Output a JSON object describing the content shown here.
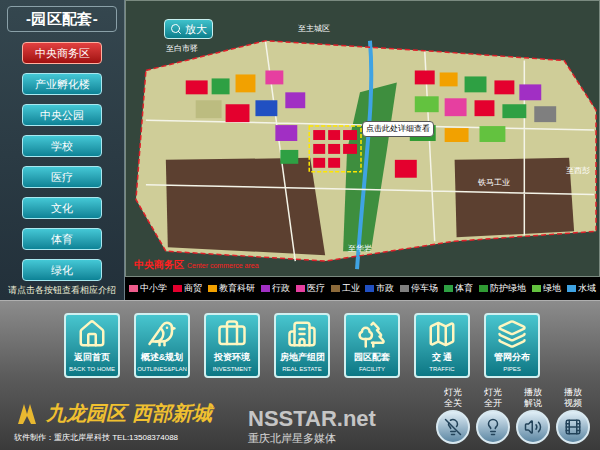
{
  "sidebar": {
    "title": "-园区配套-",
    "items": [
      {
        "label": "中央商务区",
        "selected": true
      },
      {
        "label": "产业孵化楼",
        "selected": false
      },
      {
        "label": "中央公园",
        "selected": false
      },
      {
        "label": "学校",
        "selected": false
      },
      {
        "label": "医疗",
        "selected": false
      },
      {
        "label": "文化",
        "selected": false
      },
      {
        "label": "体育",
        "selected": false
      },
      {
        "label": "绿化",
        "selected": false
      }
    ],
    "hint": "请点击各按钮查看相应介绍"
  },
  "map": {
    "zoom_button": "放大",
    "labels": [
      "至白市驿",
      "至主城区",
      "至西彭",
      "铁马工业",
      "至华岩"
    ],
    "callout": "点击此处详细查看",
    "area_title": "中央商务区",
    "area_subtitle": "Center commerce area"
  },
  "legend": [
    {
      "label": "中小学",
      "color": "#ee5c8c"
    },
    {
      "label": "商贸",
      "color": "#e4002e"
    },
    {
      "label": "教育科研",
      "color": "#f2a100"
    },
    {
      "label": "行政",
      "color": "#a12fc4"
    },
    {
      "label": "医疗",
      "color": "#e63fa0"
    },
    {
      "label": "工业",
      "color": "#8c6a3a"
    },
    {
      "label": "市政",
      "color": "#2150c2"
    },
    {
      "label": "停车场",
      "color": "#7f7f7f"
    },
    {
      "label": "体育",
      "color": "#2ea043"
    },
    {
      "label": "防护绿地",
      "color": "#2f9a33"
    },
    {
      "label": "绿地",
      "color": "#63c23f"
    },
    {
      "label": "水域",
      "color": "#3fa3e3"
    }
  ],
  "nav": [
    {
      "label": "返回首页",
      "sublabel": "BACK TO HOME"
    },
    {
      "label": "概述&规划",
      "sublabel": "OUTLINES&PLAN"
    },
    {
      "label": "投资环境",
      "sublabel": "INVESTMENT"
    },
    {
      "label": "房地产组团",
      "sublabel": "REAL ESTATE"
    },
    {
      "label": "园区配套",
      "sublabel": "FACILITY"
    },
    {
      "label": "交 通",
      "sublabel": "TRAFFIC"
    },
    {
      "label": "管网分布",
      "sublabel": "PIPES"
    }
  ],
  "logo": {
    "name": "九龙园区",
    "slogan": "西部新城"
  },
  "controls": [
    {
      "label": "灯光全关"
    },
    {
      "label": "灯光全开"
    },
    {
      "label": "播放解说"
    },
    {
      "label": "播放视频"
    }
  ],
  "credit": "软件制作：重庆北岸星科技 TEL:13508374088",
  "watermark": {
    "brand": "NSSTAR.net",
    "subtitle": "重庆北岸星多媒体"
  }
}
